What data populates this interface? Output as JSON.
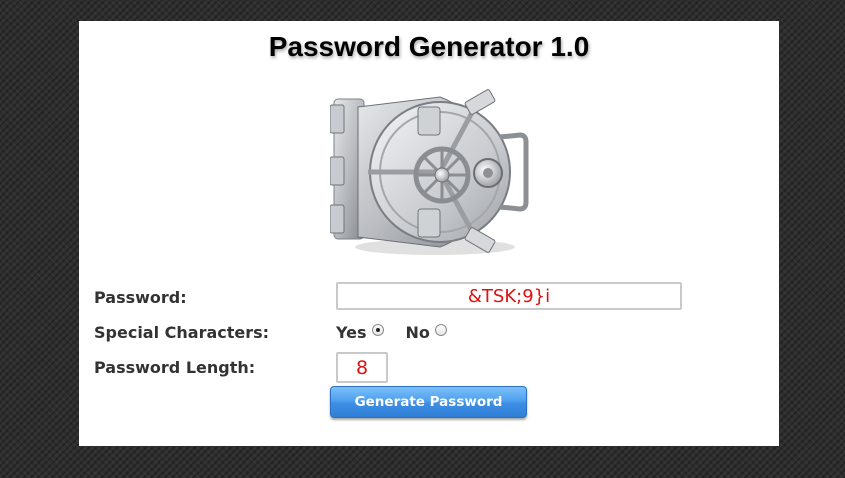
{
  "page": {
    "title": "Password Generator 1.0"
  },
  "image": {
    "icon": "vault-door-icon"
  },
  "form": {
    "password": {
      "label": "Password:",
      "value": "&TSK;9}i"
    },
    "special_characters": {
      "label": "Special Characters:",
      "yes_label": "Yes",
      "no_label": "No",
      "selected": "Yes"
    },
    "length": {
      "label": "Password Length:",
      "value": "8"
    },
    "generate_button": {
      "label": "Generate Password"
    }
  },
  "colors": {
    "background": "#2e2e2e",
    "panel": "#ffffff",
    "value_text": "#e01010",
    "button": "#3c8de3"
  }
}
